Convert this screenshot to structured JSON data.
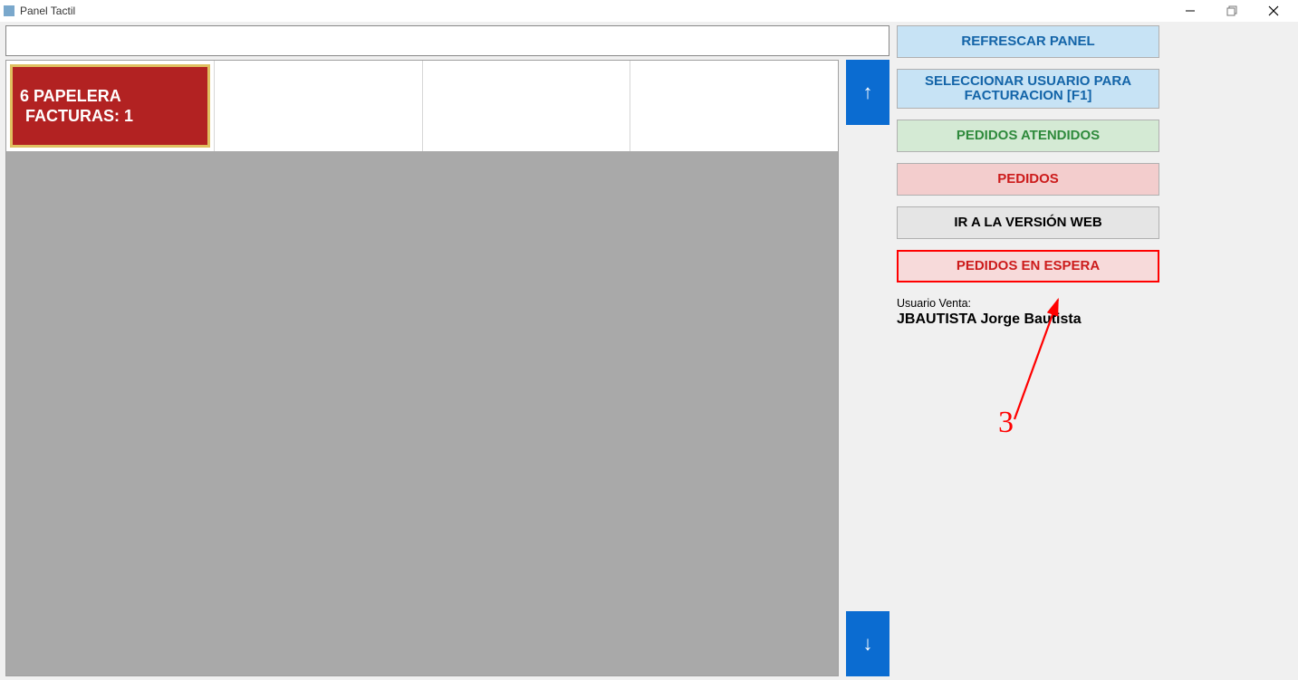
{
  "window": {
    "title": "Panel Tactil"
  },
  "search": {
    "value": "",
    "placeholder": ""
  },
  "tile": {
    "line1": "6 PAPELERA",
    "line2": "FACTURAS: 1"
  },
  "scroll": {
    "up": "↑",
    "down": "↓"
  },
  "sidebar": {
    "refrescar": "REFRESCAR PANEL",
    "seleccionar_usuario": "SELECCIONAR USUARIO PARA FACTURACION [F1]",
    "pedidos_atendidos": "PEDIDOS ATENDIDOS",
    "pedidos": "PEDIDOS",
    "version_web": "IR A LA VERSIÓN WEB",
    "pedidos_en_espera": "PEDIDOS EN ESPERA"
  },
  "user": {
    "label": "Usuario Venta:",
    "name": "JBAUTISTA Jorge Bautista"
  },
  "annotation": {
    "number": "3"
  }
}
